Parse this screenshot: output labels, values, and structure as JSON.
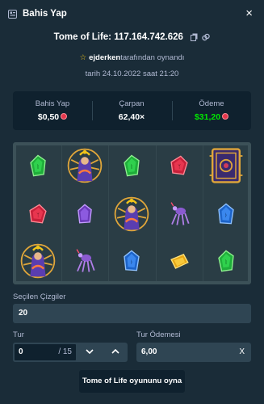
{
  "header": {
    "title": "Bahis Yap",
    "close_label": "×"
  },
  "game": {
    "name": "Tome of Life:",
    "bet_id": "117.164.742.626"
  },
  "played_by": {
    "user": "ejderken",
    "suffix": "tarafından oynandı"
  },
  "date_text": "tarih 24.10.2022 saat 21:20",
  "stats": {
    "bet": {
      "label": "Bahis Yap",
      "value": "$0,50"
    },
    "multiplier": {
      "label": "Çarpan",
      "value": "62,40×"
    },
    "payout": {
      "label": "Ödeme",
      "value": "$31,20"
    }
  },
  "board": {
    "grid": [
      [
        "gem-green",
        "sorceress",
        "gem-green",
        "gem-red",
        "book"
      ],
      [
        "gem-red",
        "gem-purple",
        "sorceress",
        "spider",
        "gem-blue"
      ],
      [
        "sorceress",
        "spider",
        "gem-blue",
        "gem-yellow",
        "gem-green"
      ]
    ]
  },
  "lines": {
    "label": "Seçilen Çizgiler",
    "value": "20"
  },
  "round": {
    "label": "Tur",
    "value": "0",
    "total": "/ 15",
    "down_label": "∨",
    "up_label": "∧"
  },
  "round_payout": {
    "label": "Tur Ödemesi",
    "value": "6,00",
    "clear_label": "X"
  },
  "play_button": {
    "label": "Tome of Life oyununu oyna"
  },
  "colors": {
    "payout_green": "#00e701",
    "coin_red": "#e2374c",
    "background": "#1a2c38",
    "panel": "#0f212e"
  }
}
